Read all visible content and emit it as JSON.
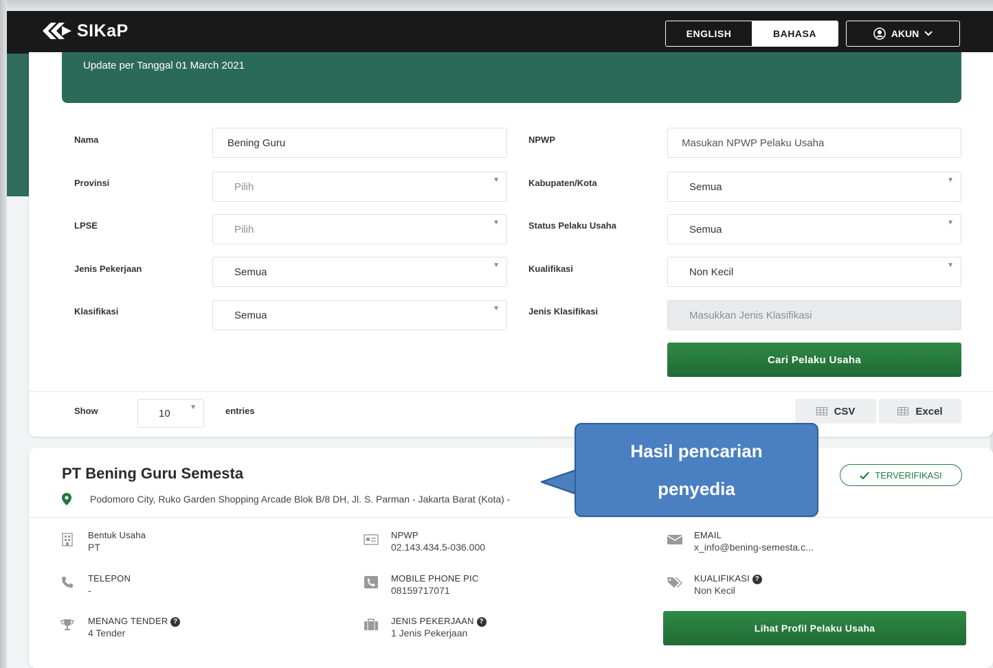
{
  "navbar": {
    "logo_text": "SIKaP",
    "lang_english": "ENGLISH",
    "lang_bahasa": "BAHASA",
    "account_label": "AKUN"
  },
  "banner": {
    "update_text": "Update per Tanggal 01 March 2021"
  },
  "filters": {
    "nama_label": "Nama",
    "nama_value": "Bening Guru",
    "npwp_label": "NPWP",
    "npwp_placeholder": "Masukan NPWP Pelaku Usaha",
    "provinsi_label": "Provinsi",
    "provinsi_value": "Pilih",
    "kabupaten_label": "Kabupaten/Kota",
    "kabupaten_value": "Semua",
    "lpse_label": "LPSE",
    "lpse_value": "Pilih",
    "status_label": "Status Pelaku Usaha",
    "status_value": "Semua",
    "jenis_pekerjaan_label": "Jenis Pekerjaan",
    "jenis_pekerjaan_value": "Semua",
    "kualifikasi_label": "Kualifikasi",
    "kualifikasi_value": "Non Kecil",
    "klasifikasi_label": "Klasifikasi",
    "klasifikasi_value": "Semua",
    "jenis_klasifikasi_label": "Jenis Klasifikasi",
    "jenis_klasifikasi_placeholder": "Masukkan Jenis Klasifikasi",
    "search_button": "Cari Pelaku Usaha"
  },
  "table_controls": {
    "show_label": "Show",
    "entries_value": "10",
    "entries_label": "entries",
    "csv_button": "CSV",
    "excel_button": "Excel"
  },
  "result": {
    "company_name": "PT Bening Guru Semesta",
    "address": "Podomoro City, Ruko Garden Shopping Arcade Blok B/8 DH, Jl. S. Parman - Jakarta Barat (Kota) -",
    "verified_label": "TERVERIFIKASI",
    "bentuk_usaha_title": "Bentuk Usaha",
    "bentuk_usaha_value": "PT",
    "npwp_title": "NPWP",
    "npwp_value": "02.143.434.5-036.000",
    "email_title": "EMAIL",
    "email_value": "x_info@bening-semesta.c...",
    "telepon_title": "TELEPON",
    "telepon_value": "-",
    "mobile_title": "MOBILE PHONE PIC",
    "mobile_value": "08159717071",
    "kualifikasi_title": "KUALIFIKASI",
    "kualifikasi_value": "Non Kecil",
    "menang_title": "MENANG TENDER",
    "menang_value": "4 Tender",
    "jenis_pekerjaan_title": "JENIS PEKERJAAN",
    "jenis_pekerjaan_value": "1 Jenis Pekerjaan",
    "profile_button": "Lihat Profil Pelaku Usaha"
  },
  "callout": {
    "line1": "Hasil pencarian",
    "line2": "penyedia"
  },
  "colors": {
    "navbar": "#191919",
    "banner": "#2c6a58",
    "button_green": "#1f6a34",
    "callout": "#4a7fc1"
  }
}
